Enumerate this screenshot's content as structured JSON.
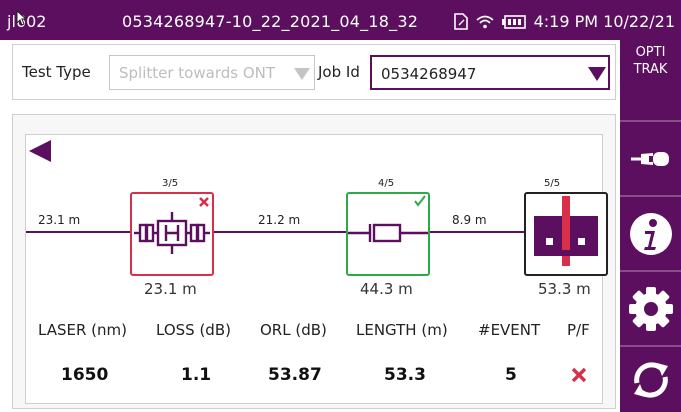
{
  "titlebar": {
    "device": "jl602",
    "file": "0534268947-10_22_2021_04_18_32",
    "time": "4:19 PM 10/22/21"
  },
  "form": {
    "test_type_label": "Test Type",
    "test_type_value": "Splitter towards ONT",
    "job_id_label": "Job Id",
    "job_id_value": "0534268947"
  },
  "sidebar": {
    "brand_line1": "OPTI",
    "brand_line2": "TRAK",
    "buttons": [
      "connector-inspection",
      "info",
      "settings",
      "refresh"
    ]
  },
  "link": {
    "segments": [
      "23.1 m",
      "21.2 m",
      "8.9 m"
    ],
    "events": [
      {
        "count": "3/5",
        "type": "splitter",
        "status": "fail",
        "distance": "23.1 m",
        "color": "#d9304a"
      },
      {
        "count": "4/5",
        "type": "connector",
        "status": "pass",
        "distance": "44.3 m",
        "color": "#2ea84a"
      },
      {
        "count": "5/5",
        "type": "ont",
        "status": "end",
        "distance": "53.3 m",
        "color": "#222222"
      }
    ]
  },
  "results": {
    "headers": [
      "LASER (nm)",
      "LOSS (dB)",
      "ORL (dB)",
      "LENGTH (m)",
      "#EVENT",
      "P/F"
    ],
    "values": [
      "1650",
      "1.1",
      "53.87",
      "53.3",
      "5"
    ],
    "pass_fail": "fail"
  },
  "colors": {
    "brand_purple": "#5b0f5e",
    "fail_red": "#d9304a",
    "pass_green": "#2ea84a"
  }
}
